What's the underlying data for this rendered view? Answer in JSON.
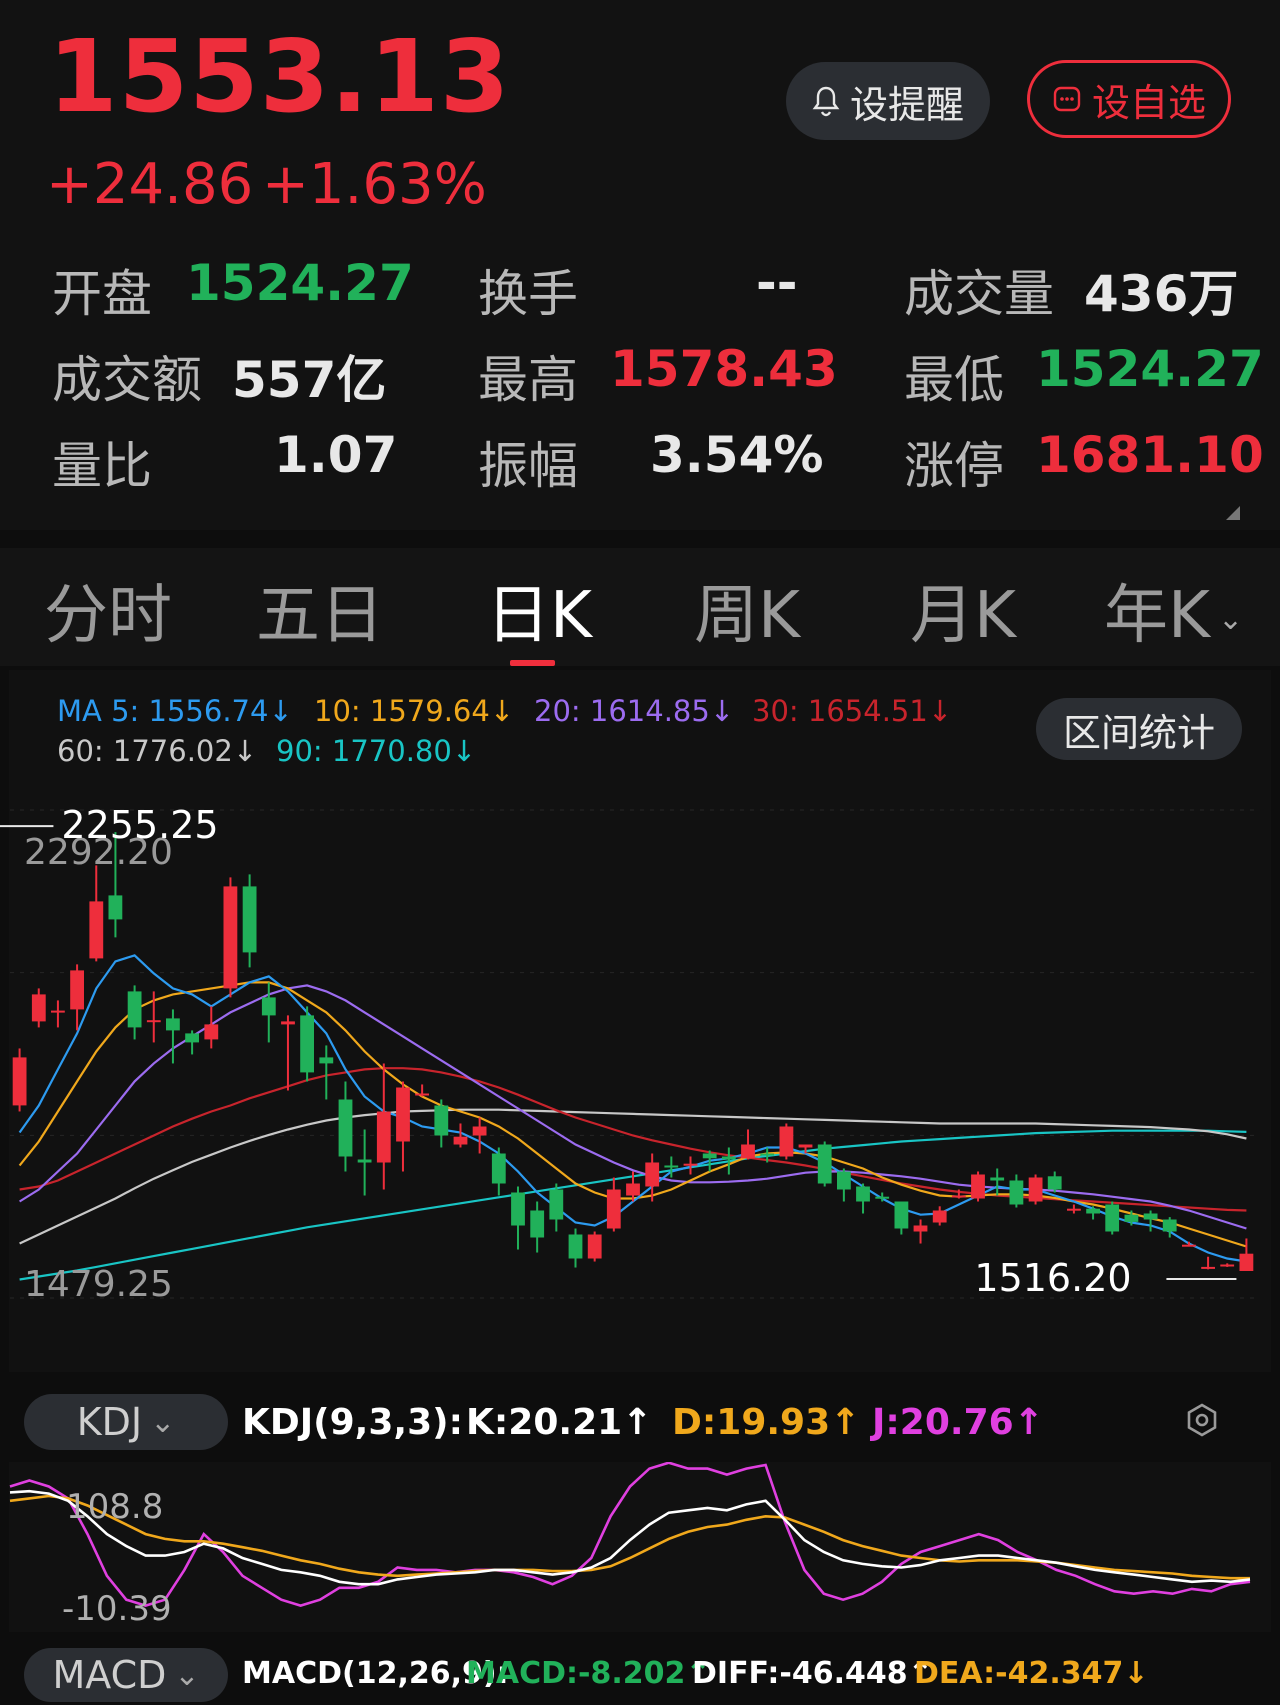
{
  "quote": {
    "price": "1553.13",
    "change": "+24.86",
    "change_pct": "+1.63%",
    "alert_label": "设提醒",
    "watch_label": "设自选",
    "stats": {
      "open_label": "开盘",
      "open_value": "1524.27",
      "turnover_label": "换手",
      "turnover_value": "--",
      "volume_label": "成交量",
      "volume_value": "436万",
      "amount_label": "成交额",
      "amount_value": "557亿",
      "high_label": "最高",
      "high_value": "1578.43",
      "low_label": "最低",
      "low_value": "1524.27",
      "ratio_label": "量比",
      "ratio_value": "1.07",
      "amplitude_label": "振幅",
      "amplitude_value": "3.54%",
      "limit_label": "涨停",
      "limit_value": "1681.10"
    }
  },
  "tabs": [
    {
      "label": "分时",
      "active": false
    },
    {
      "label": "五日",
      "active": false
    },
    {
      "label": "日K",
      "active": true
    },
    {
      "label": "周K",
      "active": false
    },
    {
      "label": "月K",
      "active": false
    },
    {
      "label": "年K",
      "active": false
    }
  ],
  "ma_legend": {
    "ma5": "MA 5: 1556.74↓",
    "ma10": "10: 1579.64↓",
    "ma20": "20: 1614.85↓",
    "ma30": "30: 1654.51↓",
    "ma60": "60: 1776.02↓",
    "ma90": "90: 1770.80↓",
    "range_stats": "区间统计"
  },
  "colors": {
    "up": "#ee2e3c",
    "down": "#21b15a",
    "ma5": "#2d9bf0",
    "ma10": "#f0a81c",
    "ma20": "#9c6cf0",
    "ma30": "#c8242c",
    "ma60": "#c8c8c8",
    "ma90": "#19c5c5",
    "k": "#ffffff",
    "d": "#f0a81c",
    "j": "#e040e0"
  },
  "chart_data": {
    "type": "candlestick",
    "ylim": [
      1479.25,
      2292.2
    ],
    "y_top_label": "2292.20",
    "y_bottom_label": "1479.25",
    "max_marker": "2255.25",
    "min_marker": "1516.20",
    "candles": [
      {
        "o": 1800,
        "c": 1880,
        "h": 1895,
        "l": 1790
      },
      {
        "o": 1940,
        "c": 1985,
        "h": 1995,
        "l": 1930
      },
      {
        "o": 1955,
        "c": 1958,
        "h": 1975,
        "l": 1930
      },
      {
        "o": 1960,
        "c": 2025,
        "h": 2035,
        "l": 1925
      },
      {
        "o": 2045,
        "c": 2140,
        "h": 2200,
        "l": 2040
      },
      {
        "o": 2150,
        "c": 2110,
        "h": 2255.25,
        "l": 2080
      },
      {
        "o": 1990,
        "c": 1930,
        "h": 2000,
        "l": 1910
      },
      {
        "o": 1940,
        "c": 1942,
        "h": 1990,
        "l": 1905
      },
      {
        "o": 1945,
        "c": 1925,
        "h": 1960,
        "l": 1870
      },
      {
        "o": 1920,
        "c": 1905,
        "h": 1925,
        "l": 1885
      },
      {
        "o": 1910,
        "c": 1935,
        "h": 1965,
        "l": 1895
      },
      {
        "o": 1995,
        "c": 2165,
        "h": 2180,
        "l": 1980
      },
      {
        "o": 2165,
        "c": 2055,
        "h": 2185,
        "l": 2030
      },
      {
        "o": 1980,
        "c": 1950,
        "h": 2005,
        "l": 1905
      },
      {
        "o": 1935,
        "c": 1940,
        "h": 1950,
        "l": 1825
      },
      {
        "o": 1950,
        "c": 1855,
        "h": 1965,
        "l": 1840
      },
      {
        "o": 1880,
        "c": 1870,
        "h": 1900,
        "l": 1810
      },
      {
        "o": 1810,
        "c": 1715,
        "h": 1840,
        "l": 1690
      },
      {
        "o": 1710,
        "c": 1705,
        "h": 1760,
        "l": 1650
      },
      {
        "o": 1705,
        "c": 1790,
        "h": 1870,
        "l": 1660
      },
      {
        "o": 1740,
        "c": 1830,
        "h": 1840,
        "l": 1690
      },
      {
        "o": 1820,
        "c": 1820,
        "h": 1835,
        "l": 1815
      },
      {
        "o": 1800,
        "c": 1750,
        "h": 1810,
        "l": 1730
      },
      {
        "o": 1735,
        "c": 1748,
        "h": 1770,
        "l": 1730
      },
      {
        "o": 1750,
        "c": 1765,
        "h": 1780,
        "l": 1720
      },
      {
        "o": 1720,
        "c": 1670,
        "h": 1730,
        "l": 1650
      },
      {
        "o": 1655,
        "c": 1600,
        "h": 1665,
        "l": 1560
      },
      {
        "o": 1625,
        "c": 1580,
        "h": 1640,
        "l": 1555
      },
      {
        "o": 1660,
        "c": 1610,
        "h": 1670,
        "l": 1590
      },
      {
        "o": 1585,
        "c": 1545,
        "h": 1595,
        "l": 1530
      },
      {
        "o": 1545,
        "c": 1585,
        "h": 1590,
        "l": 1540
      },
      {
        "o": 1595,
        "c": 1660,
        "h": 1680,
        "l": 1590
      },
      {
        "o": 1650,
        "c": 1670,
        "h": 1690,
        "l": 1640
      },
      {
        "o": 1665,
        "c": 1705,
        "h": 1720,
        "l": 1640
      },
      {
        "o": 1700,
        "c": 1698,
        "h": 1715,
        "l": 1680
      },
      {
        "o": 1700,
        "c": 1703,
        "h": 1715,
        "l": 1685
      },
      {
        "o": 1720,
        "c": 1712,
        "h": 1725,
        "l": 1690
      },
      {
        "o": 1715,
        "c": 1710,
        "h": 1730,
        "l": 1685
      },
      {
        "o": 1712,
        "c": 1735,
        "h": 1760,
        "l": 1710
      },
      {
        "o": 1720,
        "c": 1718,
        "h": 1730,
        "l": 1705
      },
      {
        "o": 1715,
        "c": 1765,
        "h": 1770,
        "l": 1710
      },
      {
        "o": 1730,
        "c": 1735,
        "h": 1735,
        "l": 1720
      },
      {
        "o": 1735,
        "c": 1670,
        "h": 1740,
        "l": 1665
      },
      {
        "o": 1690,
        "c": 1660,
        "h": 1695,
        "l": 1640
      },
      {
        "o": 1665,
        "c": 1640,
        "h": 1670,
        "l": 1620
      },
      {
        "o": 1648,
        "c": 1645,
        "h": 1655,
        "l": 1640
      },
      {
        "o": 1640,
        "c": 1595,
        "h": 1640,
        "l": 1585
      },
      {
        "o": 1590,
        "c": 1600,
        "h": 1610,
        "l": 1570
      },
      {
        "o": 1605,
        "c": 1625,
        "h": 1632,
        "l": 1600
      },
      {
        "o": 1650,
        "c": 1650,
        "h": 1660,
        "l": 1645
      },
      {
        "o": 1645,
        "c": 1685,
        "h": 1690,
        "l": 1640
      },
      {
        "o": 1680,
        "c": 1675,
        "h": 1695,
        "l": 1650
      },
      {
        "o": 1675,
        "c": 1635,
        "h": 1685,
        "l": 1630
      },
      {
        "o": 1640,
        "c": 1680,
        "h": 1685,
        "l": 1635
      },
      {
        "o": 1682,
        "c": 1660,
        "h": 1690,
        "l": 1655
      },
      {
        "o": 1628,
        "c": 1628,
        "h": 1635,
        "l": 1620
      },
      {
        "o": 1628,
        "c": 1620,
        "h": 1632,
        "l": 1610
      },
      {
        "o": 1635,
        "c": 1590,
        "h": 1640,
        "l": 1585
      },
      {
        "o": 1618,
        "c": 1606,
        "h": 1625,
        "l": 1600
      },
      {
        "o": 1620,
        "c": 1610,
        "h": 1625,
        "l": 1590
      },
      {
        "o": 1610,
        "c": 1590,
        "h": 1614,
        "l": 1580
      },
      {
        "o": 1568,
        "c": 1568,
        "h": 1573,
        "l": 1565
      },
      {
        "o": 1531,
        "c": 1531,
        "h": 1548,
        "l": 1527
      },
      {
        "o": 1532,
        "c": 1535,
        "h": 1537,
        "l": 1531
      },
      {
        "o": 1524.27,
        "c": 1553.13,
        "h": 1578.43,
        "l": 1524.27
      }
    ],
    "ma_series": {
      "ma5": [
        1755,
        1800,
        1860,
        1920,
        1995,
        2040,
        2050,
        2020,
        1995,
        1985,
        1965,
        1985,
        2005,
        2015,
        1990,
        1955,
        1920,
        1860,
        1815,
        1790,
        1780,
        1765,
        1760,
        1755,
        1740,
        1720,
        1690,
        1655,
        1630,
        1605,
        1600,
        1615,
        1640,
        1665,
        1690,
        1698,
        1708,
        1712,
        1720,
        1730,
        1730,
        1720,
        1705,
        1685,
        1665,
        1645,
        1628,
        1618,
        1620,
        1635,
        1650,
        1665,
        1660,
        1660,
        1650,
        1640,
        1628,
        1615,
        1605,
        1600,
        1590,
        1570,
        1555,
        1545,
        1540
      ],
      "ma10": [
        1700,
        1740,
        1790,
        1840,
        1890,
        1930,
        1960,
        1975,
        1985,
        1990,
        1995,
        2000,
        2005,
        2005,
        1995,
        1975,
        1955,
        1925,
        1890,
        1860,
        1835,
        1815,
        1800,
        1790,
        1780,
        1765,
        1745,
        1720,
        1695,
        1670,
        1655,
        1645,
        1645,
        1650,
        1660,
        1675,
        1690,
        1702,
        1715,
        1720,
        1722,
        1720,
        1715,
        1705,
        1695,
        1680,
        1668,
        1658,
        1650,
        1648,
        1650,
        1652,
        1652,
        1650,
        1646,
        1640,
        1635,
        1628,
        1620,
        1612,
        1605,
        1595,
        1585,
        1575,
        1565
      ],
      "ma20": [
        1640,
        1660,
        1690,
        1720,
        1760,
        1800,
        1840,
        1870,
        1895,
        1915,
        1935,
        1955,
        1970,
        1985,
        1995,
        2000,
        1990,
        1975,
        1955,
        1935,
        1915,
        1895,
        1875,
        1855,
        1835,
        1815,
        1795,
        1775,
        1755,
        1735,
        1720,
        1705,
        1692,
        1682,
        1675,
        1672,
        1672,
        1673,
        1675,
        1678,
        1683,
        1688,
        1690,
        1690,
        1688,
        1685,
        1682,
        1678,
        1673,
        1668,
        1665,
        1663,
        1661,
        1660,
        1658,
        1655,
        1652,
        1648,
        1644,
        1640,
        1633,
        1625,
        1615,
        1605,
        1595
      ],
      "ma30": [
        1660,
        1665,
        1675,
        1690,
        1705,
        1720,
        1735,
        1750,
        1765,
        1778,
        1790,
        1800,
        1812,
        1822,
        1832,
        1842,
        1850,
        1855,
        1860,
        1862,
        1862,
        1860,
        1855,
        1848,
        1840,
        1830,
        1818,
        1805,
        1792,
        1780,
        1770,
        1760,
        1750,
        1742,
        1735,
        1728,
        1722,
        1717,
        1713,
        1709,
        1705,
        1700,
        1694,
        1688,
        1682,
        1676,
        1670,
        1665,
        1660,
        1656,
        1653,
        1650,
        1648,
        1646,
        1644,
        1642,
        1640,
        1638,
        1636,
        1634,
        1632,
        1630,
        1628,
        1626,
        1625
      ],
      "ma60": [
        1570,
        1585,
        1600,
        1615,
        1630,
        1645,
        1662,
        1678,
        1692,
        1706,
        1718,
        1730,
        1741,
        1751,
        1760,
        1768,
        1775,
        1780,
        1784,
        1787,
        1790,
        1791,
        1792,
        1793,
        1793,
        1793,
        1792,
        1791,
        1790,
        1789,
        1788,
        1787,
        1786,
        1785,
        1784,
        1783,
        1782,
        1781,
        1780,
        1779,
        1778,
        1777,
        1776,
        1775,
        1774,
        1773,
        1772,
        1771,
        1770,
        1770,
        1770,
        1770,
        1770,
        1770,
        1769,
        1768,
        1767,
        1766,
        1765,
        1764,
        1762,
        1760,
        1757,
        1752,
        1745
      ],
      "ma90": [
        1510,
        1515,
        1520,
        1525,
        1531,
        1537,
        1543,
        1549,
        1555,
        1561,
        1567,
        1573,
        1579,
        1585,
        1591,
        1597,
        1602,
        1607,
        1612,
        1617,
        1622,
        1627,
        1632,
        1637,
        1642,
        1647,
        1652,
        1657,
        1662,
        1667,
        1672,
        1677,
        1682,
        1687,
        1692,
        1697,
        1702,
        1707,
        1712,
        1716,
        1720,
        1724,
        1728,
        1731,
        1734,
        1737,
        1740,
        1742,
        1744,
        1746,
        1748,
        1750,
        1752,
        1754,
        1755,
        1756,
        1757,
        1758,
        1758,
        1758,
        1758,
        1758,
        1758,
        1757,
        1756
      ]
    }
  },
  "kdj": {
    "selector": "KDJ",
    "title": "KDJ(9,3,3):",
    "k_label": "K:20.21↑",
    "d_label": "D:19.93↑",
    "j_label": "J:20.76↑",
    "y_top_label": "108.8",
    "y_bottom_label": "-10.39",
    "ylim": [
      -10.39,
      108.8
    ],
    "k": [
      95,
      96,
      94,
      88,
      75,
      60,
      50,
      42,
      42,
      45,
      52,
      48,
      40,
      35,
      30,
      28,
      25,
      20,
      18,
      18,
      22,
      24,
      26,
      27,
      28,
      30,
      30,
      28,
      26,
      28,
      32,
      40,
      55,
      68,
      78,
      80,
      82,
      80,
      85,
      88,
      72,
      55,
      45,
      38,
      35,
      33,
      32,
      34,
      38,
      40,
      42,
      42,
      40,
      38,
      36,
      33,
      30,
      28,
      26,
      24,
      22,
      20,
      21,
      20,
      22
    ],
    "d": [
      88,
      90,
      92,
      90,
      84,
      76,
      68,
      60,
      56,
      54,
      54,
      52,
      49,
      46,
      42,
      38,
      35,
      31,
      28,
      26,
      25,
      26,
      27,
      28,
      29,
      30,
      30,
      30,
      29,
      29,
      30,
      33,
      40,
      48,
      56,
      62,
      66,
      68,
      72,
      75,
      74,
      68,
      62,
      55,
      50,
      46,
      42,
      40,
      38,
      37,
      38,
      38,
      38,
      37,
      36,
      34,
      32,
      30,
      29,
      28,
      27,
      25,
      24,
      23,
      23
    ],
    "j": [
      100,
      105,
      100,
      90,
      60,
      25,
      5,
      0,
      5,
      30,
      60,
      45,
      25,
      15,
      5,
      0,
      5,
      15,
      15,
      20,
      32,
      30,
      30,
      28,
      30,
      30,
      28,
      24,
      18,
      25,
      40,
      75,
      100,
      115,
      120,
      115,
      115,
      110,
      115,
      118,
      70,
      30,
      10,
      5,
      10,
      20,
      35,
      45,
      50,
      55,
      60,
      55,
      45,
      38,
      30,
      25,
      18,
      12,
      10,
      12,
      10,
      14,
      12,
      18,
      20
    ]
  },
  "macd": {
    "selector": "MACD",
    "title": "MACD(12,26,9):",
    "macd_label": "MACD:-8.202↑",
    "diff_label": "DIFF:-46.448↑",
    "dea_label": "DEA:-42.347↓"
  }
}
